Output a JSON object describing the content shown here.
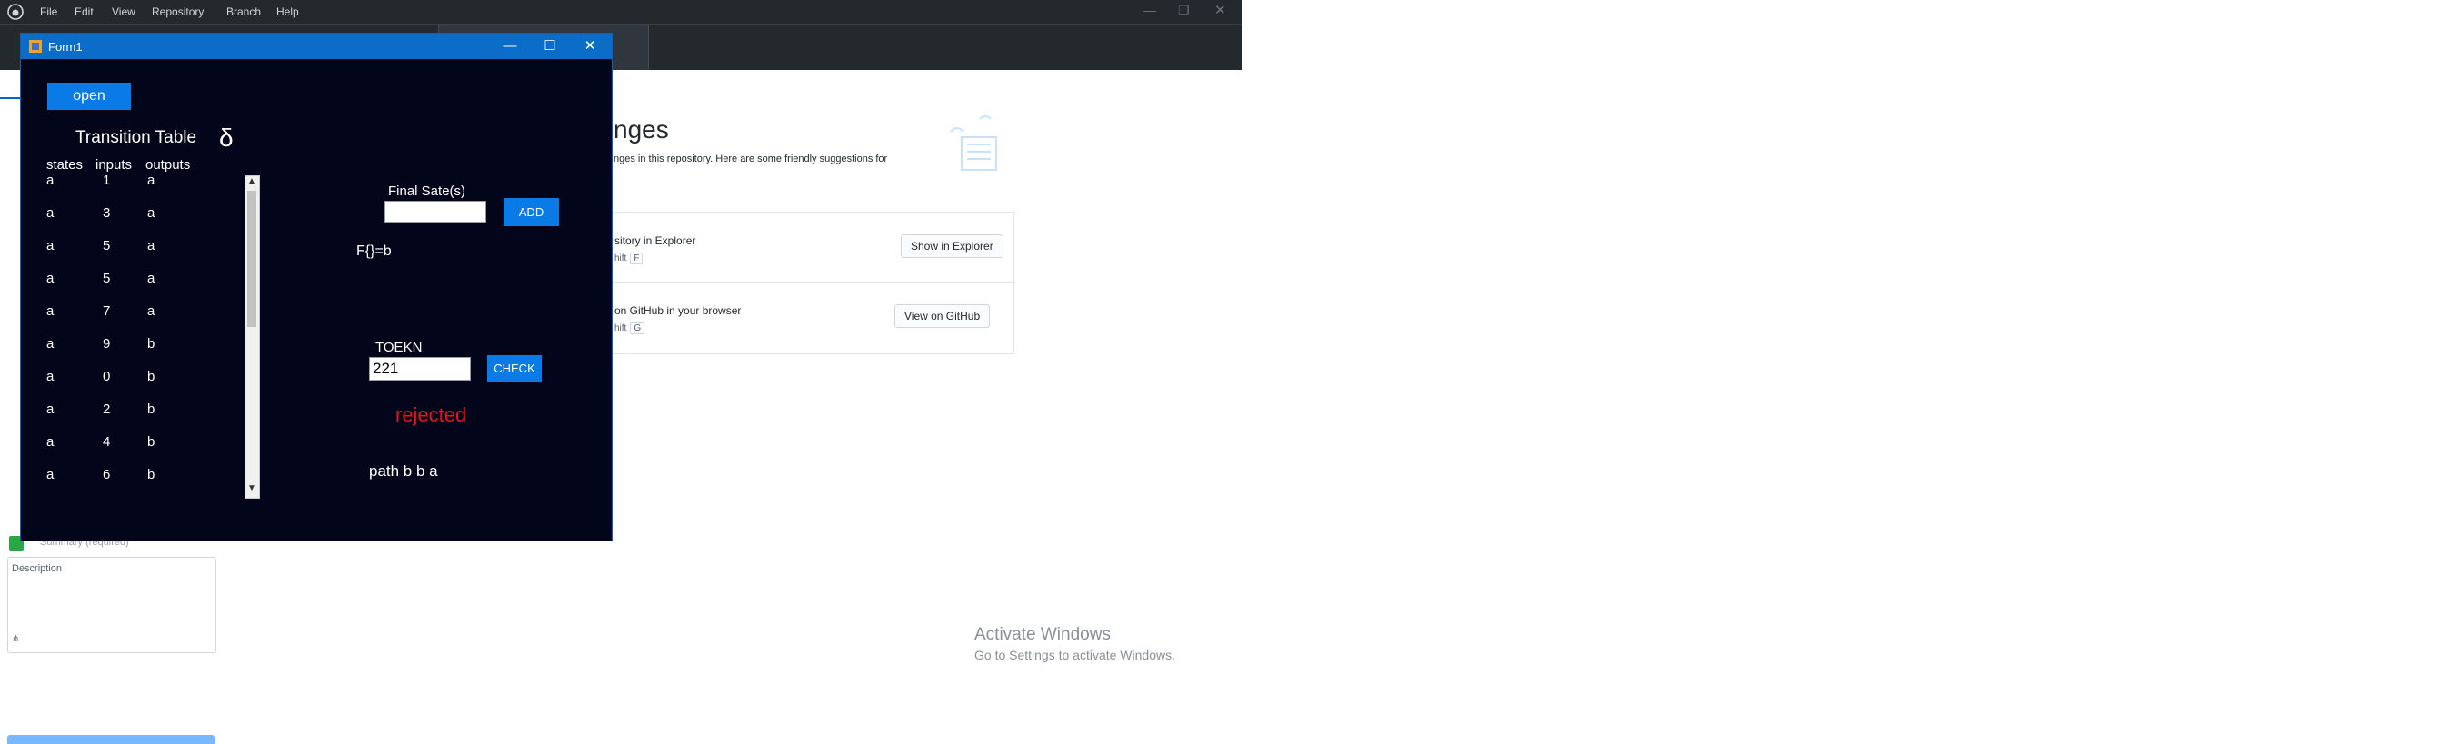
{
  "menubar": {
    "items": [
      "File",
      "Edit",
      "View",
      "Repository",
      "Branch",
      "Help"
    ]
  },
  "github": {
    "heading": "nges",
    "subtext": "nges in this repository. Here are some friendly suggestions for",
    "card1_title": "sitory in Explorer",
    "card1_shortcut_prefix": "hift",
    "card1_shortcut_key": "F",
    "card1_button": "Show in Explorer",
    "card2_title": "on GitHub in your browser",
    "card2_shortcut_prefix": "hift",
    "card2_shortcut_key": "G",
    "card2_button": "View on GitHub",
    "summary_placeholder": "Summary (required)",
    "description_placeholder": "Description"
  },
  "watermark": {
    "line1": "Activate Windows",
    "line2": "Go to Settings to activate Windows."
  },
  "form": {
    "title": "Form1",
    "open_button": "open",
    "table_title": "Transition Table",
    "delta_symbol": "δ",
    "headers": [
      "states",
      "inputs",
      "outputs"
    ],
    "rows": [
      [
        "a",
        "1",
        "a"
      ],
      [
        "a",
        "3",
        "a"
      ],
      [
        "a",
        "5",
        "a"
      ],
      [
        "a",
        "5",
        "a"
      ],
      [
        "a",
        "7",
        "a"
      ],
      [
        "a",
        "9",
        "b"
      ],
      [
        "a",
        "0",
        "b"
      ],
      [
        "a",
        "2",
        "b"
      ],
      [
        "a",
        "4",
        "b"
      ],
      [
        "a",
        "6",
        "b"
      ]
    ],
    "final_states_label": "Final Sate(s)",
    "final_states_value": "",
    "add_button": "ADD",
    "final_set_text": "F{}=b",
    "token_label": "TOEKN",
    "token_value": "221",
    "check_button": "CHECK",
    "result_text": "rejected",
    "result_color": "#e8121d",
    "path_text": "path b b a"
  }
}
